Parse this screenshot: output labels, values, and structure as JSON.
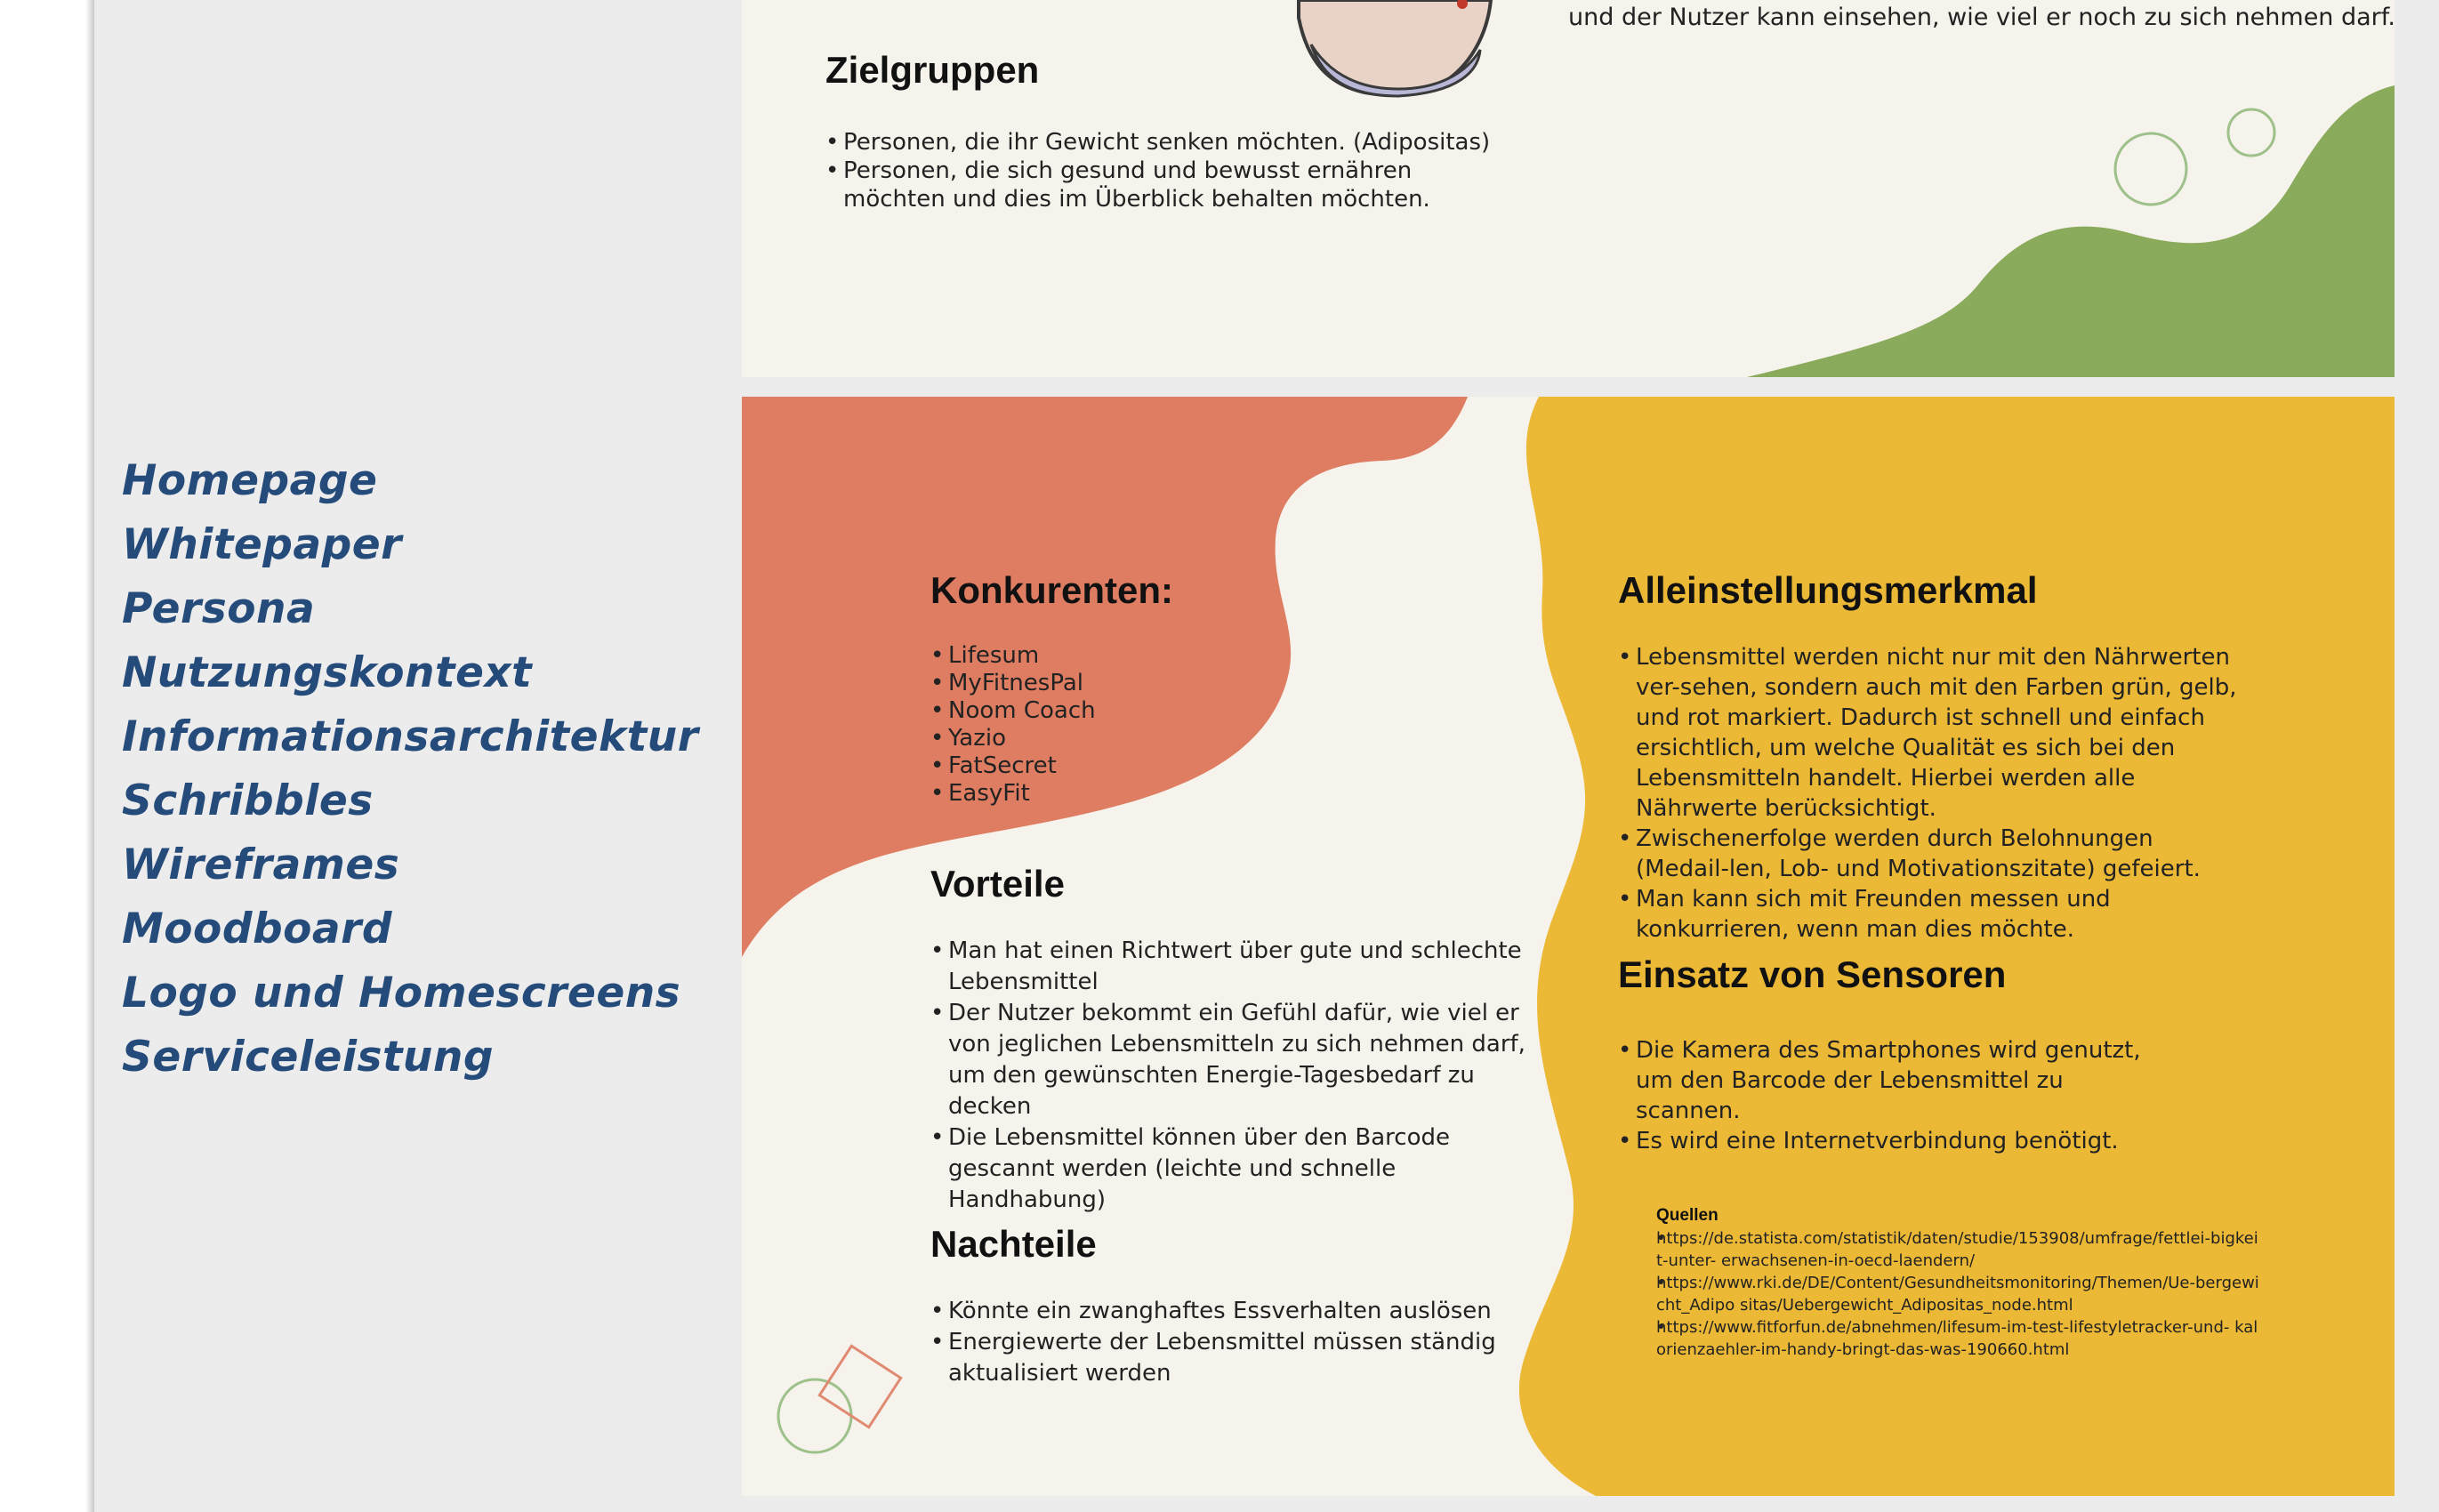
{
  "navigation": {
    "items": [
      {
        "label": "Homepage"
      },
      {
        "label": "Whitepaper"
      },
      {
        "label": "Persona"
      },
      {
        "label": "Nutzungskontext"
      },
      {
        "label": "Informationsarchitektur"
      },
      {
        "label": "Schribbles"
      },
      {
        "label": "Wireframes"
      },
      {
        "label": "Moodboard"
      },
      {
        "label": "Logo und Homescreens"
      },
      {
        "label": "Serviceleistung"
      }
    ]
  },
  "top_panel": {
    "intro_tail": "und der Nutzer kann einsehen, wie viel er noch zu sich nehmen darf.",
    "zielgruppen": {
      "title": "Zielgruppen",
      "items": [
        "Personen, die ihr Gewicht senken möchten. (Adipositas)",
        "Personen, die sich gesund und bewusst ernähren möchten und dies im Überblick behalten möchten."
      ]
    }
  },
  "bottom_panel": {
    "konkurenten": {
      "title": "Konkurenten:",
      "items": [
        "Lifesum",
        "MyFitnesPal",
        "Noom Coach",
        "Yazio",
        "FatSecret",
        "EasyFit"
      ]
    },
    "vorteile": {
      "title": "Vorteile",
      "items": [
        "Man hat einen Richtwert über gute und schlechte Lebensmittel",
        "Der Nutzer bekommt ein Gefühl dafür, wie viel er von jeglichen Lebensmitteln zu sich nehmen darf, um den gewünschten Energie-Tagesbedarf zu decken",
        "Die Lebensmittel können über den Barcode gescannt werden (leichte und schnelle Handhabung)"
      ]
    },
    "nachteile": {
      "title": "Nachteile",
      "items": [
        "Könnte ein zwanghaftes Essverhalten auslösen",
        "Energiewerte der Lebensmittel müssen ständig aktualisiert werden"
      ]
    },
    "alleinstellung": {
      "title": "Alleinstellungsmerkmal",
      "items": [
        "Lebensmittel werden nicht nur mit den Nährwerten ver-sehen, sondern auch mit den Farben grün, gelb, und rot markiert. Dadurch ist schnell und einfach ersichtlich, um welche Qualität es sich bei den Lebensmitteln handelt. Hierbei werden alle Nährwerte berücksichtigt.",
        "Zwischenerfolge werden durch Belohnungen (Medail-len, Lob- und Motivationszitate) gefeiert.",
        "Man kann sich mit Freunden messen und konkurrieren, wenn man dies möchte."
      ]
    },
    "sensoren": {
      "title": "Einsatz von Sensoren",
      "items": [
        "Die Kamera des Smartphones wird genutzt, um den Barcode der Lebensmittel zu scannen.",
        "Es wird eine Internetverbindung benötigt."
      ]
    },
    "quellen": {
      "title": "Quellen",
      "items": [
        "https://de.statista.com/statistik/daten/studie/153908/umfrage/fettlei-bigkeit-unter- erwachsenen-in-oecd-laendern/",
        "https://www.rki.de/DE/Content/Gesundheitsmonitoring/Themen/Ue-bergewicht_Adipo sitas/Uebergewicht_Adipositas_node.html",
        "https://www.fitforfun.de/abnehmen/lifesum-im-test-lifestyletracker-und- kalorienzaehler-im-handy-bringt-das-was-190660.html"
      ]
    }
  },
  "colors": {
    "page_background": "#ececec",
    "nav_text": "#244b7a",
    "panel_background": "#f6f3ec",
    "accent_green": "#8aab5c",
    "accent_orange": "#de7d61",
    "accent_yellow": "#ecb936",
    "circle_outline_green": "#9ec08a",
    "square_outline_orange": "#e08a72"
  }
}
